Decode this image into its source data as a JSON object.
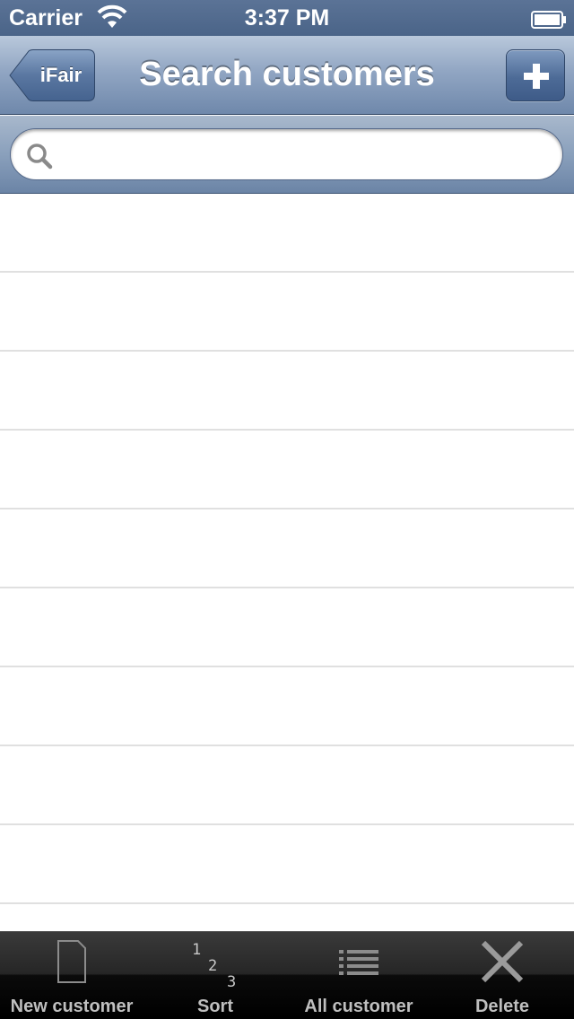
{
  "status_bar": {
    "carrier": "Carrier",
    "time": "3:37 PM"
  },
  "nav_bar": {
    "back_label": "iFair",
    "title": "Search customers",
    "add_icon": "plus-icon"
  },
  "search": {
    "placeholder": "",
    "value": ""
  },
  "table": {
    "rows": [
      "",
      "",
      "",
      "",
      "",
      "",
      "",
      "",
      "",
      ""
    ]
  },
  "toolbar": {
    "items": [
      {
        "label": "New customer",
        "icon": "blank-document-icon"
      },
      {
        "label": "Sort",
        "icon": "sort-123-icon",
        "digits": [
          "1",
          "2",
          "3"
        ]
      },
      {
        "label": "All customer",
        "icon": "list-icon"
      },
      {
        "label": "Delete",
        "icon": "x-icon"
      }
    ]
  },
  "colors": {
    "nav_tint": "#6f88ab",
    "toolbar_bg": "#000000",
    "separator": "#e0e0e0"
  }
}
